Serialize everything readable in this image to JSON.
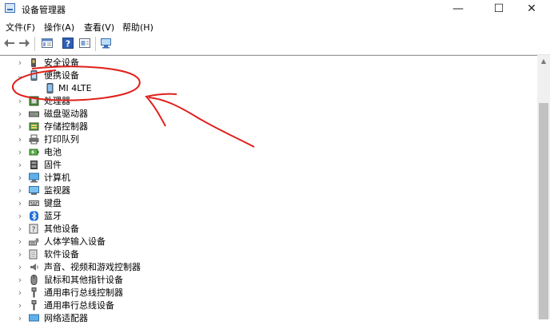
{
  "window": {
    "title": "设备管理器",
    "minimize_glyph": "—",
    "maximize_glyph": "☐",
    "close_glyph": "✕"
  },
  "menu": [
    "文件(F)",
    "操作(A)",
    "查看(V)",
    "帮助(H)"
  ],
  "toolbar": {
    "icons": [
      "back-arrow-icon",
      "forward-arrow-icon",
      "properties-icon",
      "help-icon",
      "show-hidden-icon",
      "scan-hardware-icon"
    ]
  },
  "tree": {
    "items": [
      {
        "label": "安全设备",
        "icon": "security-device-icon",
        "expanded": false,
        "level": 0
      },
      {
        "label": "便携设备",
        "icon": "portable-device-icon",
        "expanded": true,
        "level": 0
      },
      {
        "label": "MI 4LTE",
        "icon": "phone-icon",
        "level": 1
      },
      {
        "label": "处理器",
        "icon": "processor-icon",
        "expanded": false,
        "level": 0
      },
      {
        "label": "磁盘驱动器",
        "icon": "disk-drive-icon",
        "expanded": false,
        "level": 0
      },
      {
        "label": "存储控制器",
        "icon": "storage-controller-icon",
        "expanded": false,
        "level": 0
      },
      {
        "label": "打印队列",
        "icon": "printer-icon",
        "expanded": false,
        "level": 0
      },
      {
        "label": "电池",
        "icon": "battery-icon",
        "expanded": false,
        "level": 0
      },
      {
        "label": "固件",
        "icon": "firmware-icon",
        "expanded": false,
        "level": 0
      },
      {
        "label": "计算机",
        "icon": "computer-icon",
        "expanded": false,
        "level": 0
      },
      {
        "label": "监视器",
        "icon": "monitor-icon",
        "expanded": false,
        "level": 0
      },
      {
        "label": "键盘",
        "icon": "keyboard-icon",
        "expanded": false,
        "level": 0
      },
      {
        "label": "蓝牙",
        "icon": "bluetooth-icon",
        "expanded": false,
        "level": 0
      },
      {
        "label": "其他设备",
        "icon": "other-device-icon",
        "expanded": false,
        "level": 0
      },
      {
        "label": "人体学输入设备",
        "icon": "hid-icon",
        "expanded": false,
        "level": 0
      },
      {
        "label": "软件设备",
        "icon": "software-device-icon",
        "expanded": false,
        "level": 0
      },
      {
        "label": "声音、视频和游戏控制器",
        "icon": "audio-icon",
        "expanded": false,
        "level": 0
      },
      {
        "label": "鼠标和其他指针设备",
        "icon": "mouse-icon",
        "expanded": false,
        "level": 0
      },
      {
        "label": "通用串行总线控制器",
        "icon": "usb-icon",
        "expanded": false,
        "level": 0
      },
      {
        "label": "通用串行总线设备",
        "icon": "usb-icon",
        "expanded": false,
        "level": 0
      },
      {
        "label": "网络适配器",
        "icon": "network-adapter-icon",
        "expanded": false,
        "level": 0
      }
    ]
  },
  "colors": {
    "annotation": "#e0201a",
    "accent": "#2f79d6"
  }
}
